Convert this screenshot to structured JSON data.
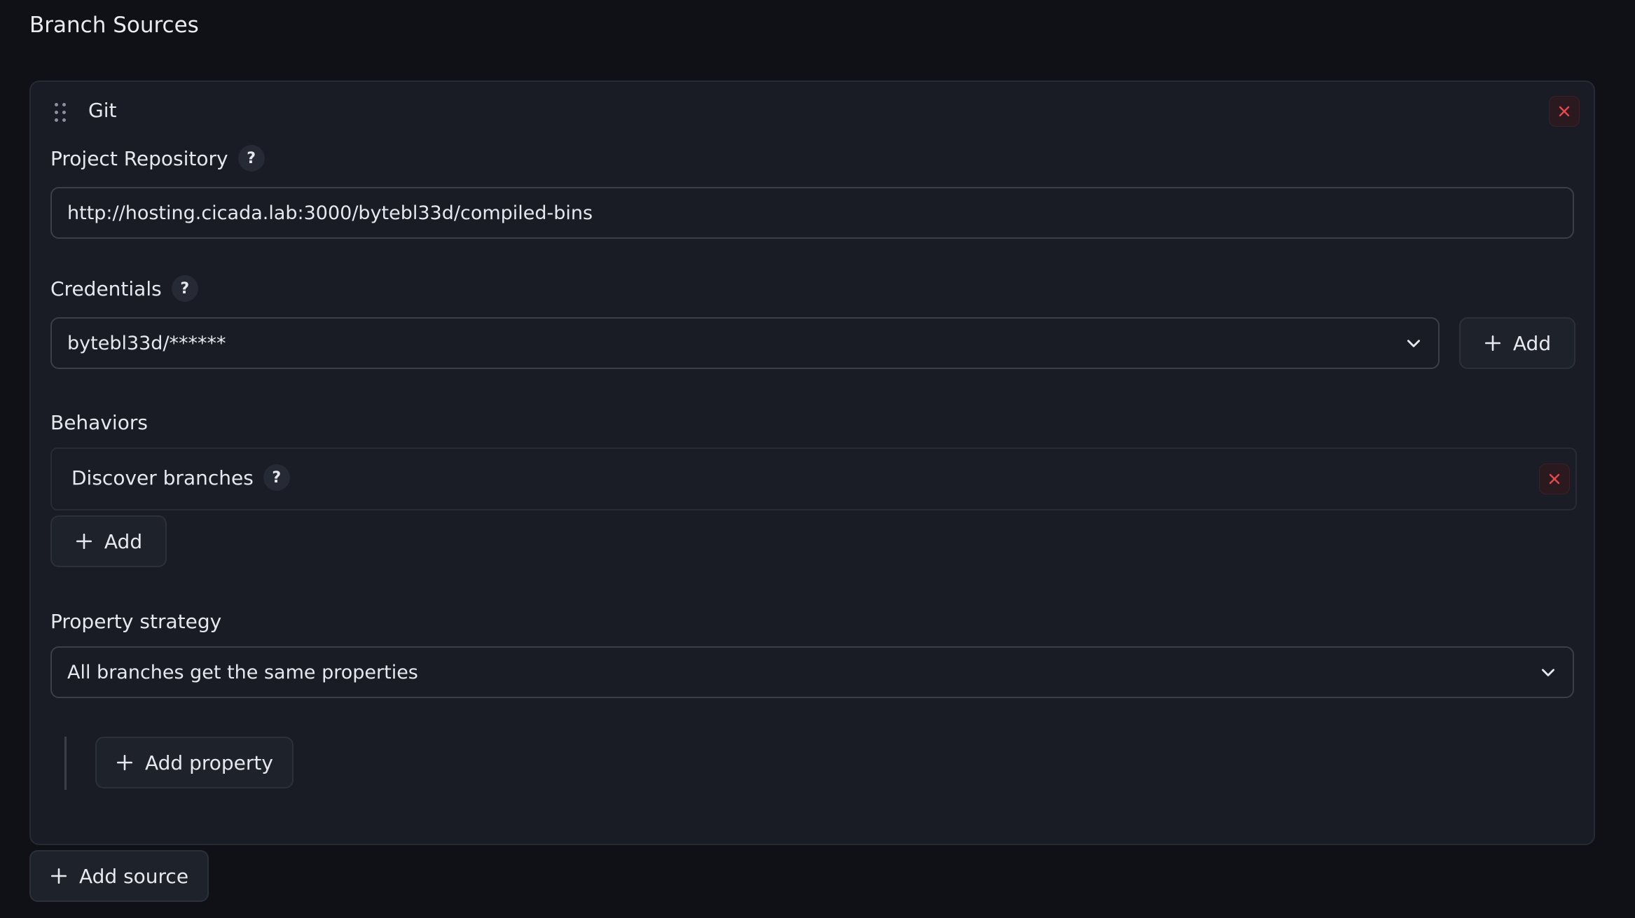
{
  "page": {
    "section_title": "Branch Sources"
  },
  "source": {
    "type_title": "Git",
    "project_repository": {
      "label": "Project Repository",
      "help": "?",
      "value": "http://hosting.cicada.lab:3000/bytebl33d/compiled-bins"
    },
    "credentials": {
      "label": "Credentials",
      "help": "?",
      "selected": "bytebl33d/******",
      "add_label": "Add"
    },
    "behaviors": {
      "label": "Behaviors",
      "items": [
        {
          "label": "Discover branches",
          "help": "?"
        }
      ],
      "add_label": "Add"
    },
    "property_strategy": {
      "label": "Property strategy",
      "selected": "All branches get the same properties",
      "add_property_label": "Add property"
    }
  },
  "add_source_label": "Add source",
  "colors": {
    "background": "#0f1117",
    "card": "#191c24",
    "delete_accent": "#e5484d"
  }
}
